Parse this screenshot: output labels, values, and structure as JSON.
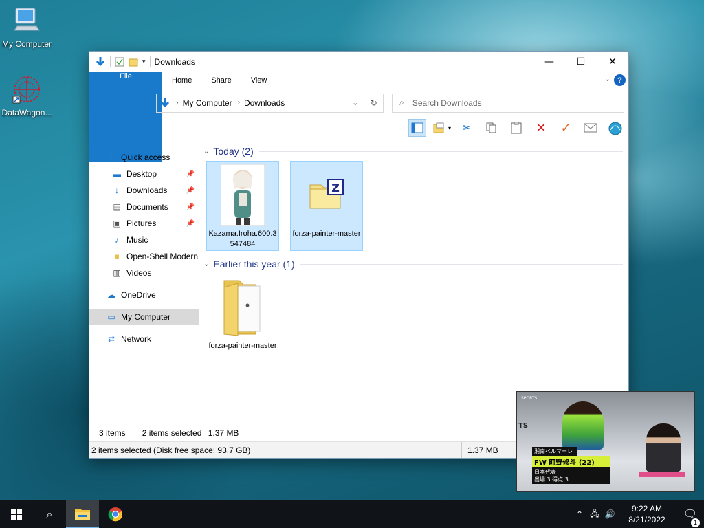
{
  "desktop": {
    "icons": [
      {
        "label": "My Computer"
      },
      {
        "label": "DataWagon..."
      }
    ]
  },
  "window": {
    "title": "Downloads",
    "controls": {
      "minimize": "—",
      "maximize": "☐",
      "close": "✕"
    },
    "ribbon_tabs": [
      "File",
      "Home",
      "Share",
      "View"
    ],
    "help": "?",
    "address": {
      "crumbs": [
        "My Computer",
        "Downloads"
      ]
    },
    "search": {
      "placeholder": "Search Downloads"
    },
    "navigation": {
      "quick_access": "Quick access",
      "items": [
        {
          "label": "Desktop",
          "icon": "desktop-icon",
          "pinned": true
        },
        {
          "label": "Downloads",
          "icon": "download-icon",
          "pinned": true
        },
        {
          "label": "Documents",
          "icon": "document-icon",
          "pinned": true
        },
        {
          "label": "Pictures",
          "icon": "pictures-icon",
          "pinned": true
        },
        {
          "label": "Music",
          "icon": "music-icon",
          "pinned": false
        },
        {
          "label": "Open-Shell Modern",
          "icon": "folder-icon",
          "pinned": false
        },
        {
          "label": "Videos",
          "icon": "videos-icon",
          "pinned": false
        }
      ],
      "onedrive": "OneDrive",
      "my_computer": "My Computer",
      "network": "Network"
    },
    "groups": [
      {
        "header": "Today (2)",
        "files": [
          {
            "name": "Kazama.Iroha.600.3547484",
            "type": "image",
            "selected": true
          },
          {
            "name": "forza-painter-master",
            "type": "zip",
            "selected": true
          }
        ]
      },
      {
        "header": "Earlier this year (1)",
        "files": [
          {
            "name": "forza-painter-master",
            "type": "folder",
            "selected": false
          }
        ]
      }
    ],
    "status_inner": {
      "count": "3 items",
      "selected": "2 items selected",
      "size": "1.37 MB"
    },
    "statusbar": {
      "left": "2 items selected (Disk free space: 93.7 GB)",
      "right": "1.37 MB"
    }
  },
  "video": {
    "brand": "SPORTS",
    "side": "TS",
    "team": "湘南ベルマーレ",
    "player": "FW 町野修斗 (22)",
    "line1": "日本代表",
    "line2": "出場 3  得点 3"
  },
  "taskbar": {
    "time": "9:22 AM",
    "date": "8/21/2022",
    "notifications": "1"
  },
  "colors": {
    "accent": "#1979ca",
    "selection": "#cce8ff",
    "group_header": "#1e3287"
  }
}
